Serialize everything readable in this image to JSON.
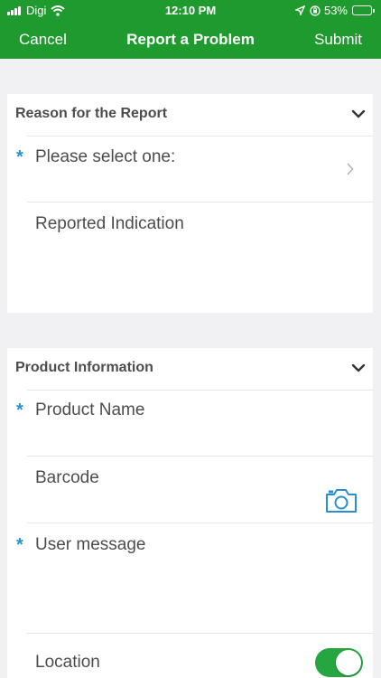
{
  "status_bar": {
    "carrier": "Digi",
    "time": "12:10 PM",
    "battery": "53%",
    "battery_level": 0.53,
    "icons": [
      "signal-icon",
      "wifi-icon",
      "location-arrow-icon",
      "orientation-lock-icon",
      "battery-icon"
    ]
  },
  "nav": {
    "cancel": "Cancel",
    "title": "Report a Problem",
    "submit": "Submit"
  },
  "reason_section": {
    "title": "Reason for the Report",
    "select": {
      "required_mark": "*",
      "label": "Please select one:"
    },
    "indication": {
      "label": "Reported Indication"
    }
  },
  "product_section": {
    "title": "Product Information",
    "product_name": {
      "required_mark": "*",
      "label": "Product Name"
    },
    "barcode": {
      "label": "Barcode"
    },
    "user_message": {
      "required_mark": "*",
      "label": "User message"
    },
    "location": {
      "label": "Location",
      "enabled": true
    }
  },
  "colors": {
    "header": "#1f9a2e",
    "required": "#2a8fd0",
    "toggle_on": "#25a640",
    "camera": "#2a8fd0"
  }
}
